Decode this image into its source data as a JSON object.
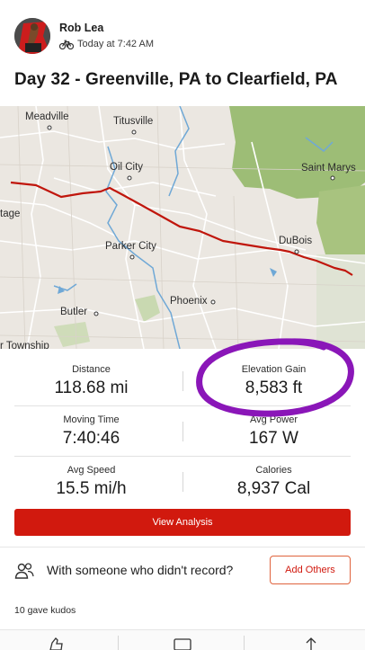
{
  "header": {
    "athlete_name": "Rob Lea",
    "timestamp": "Today at 7:42 AM",
    "activity_icon": "bike-icon"
  },
  "activity": {
    "title": "Day 32 - Greenville, PA to Clearfield, PA"
  },
  "map": {
    "labels": {
      "meadville": "Meadville",
      "titusville": "Titusville",
      "oil_city": "Oil City",
      "saint_marys": "Saint Marys",
      "tage": "tage",
      "parker_city": "Parker City",
      "dubois": "DuBois",
      "phoenix": "Phoenix",
      "butler": "Butler",
      "township": "r Township"
    },
    "route_color": "#c0160c"
  },
  "stats": {
    "distance": {
      "label": "Distance",
      "value": "118.68 mi"
    },
    "elevation": {
      "label": "Elevation Gain",
      "value": "8,583 ft"
    },
    "moving_time": {
      "label": "Moving Time",
      "value": "7:40:46"
    },
    "avg_power": {
      "label": "Avg Power",
      "value": "167 W"
    },
    "avg_speed": {
      "label": "Avg Speed",
      "value": "15.5 mi/h"
    },
    "calories": {
      "label": "Calories",
      "value": "8,937 Cal"
    }
  },
  "actions": {
    "view_analysis": "View Analysis",
    "record_prompt": "With someone who didn't record?",
    "add_others": "Add Others"
  },
  "kudos": "10 gave kudos",
  "colors": {
    "accent": "#d1190e",
    "annotation": "#8a16b8"
  }
}
